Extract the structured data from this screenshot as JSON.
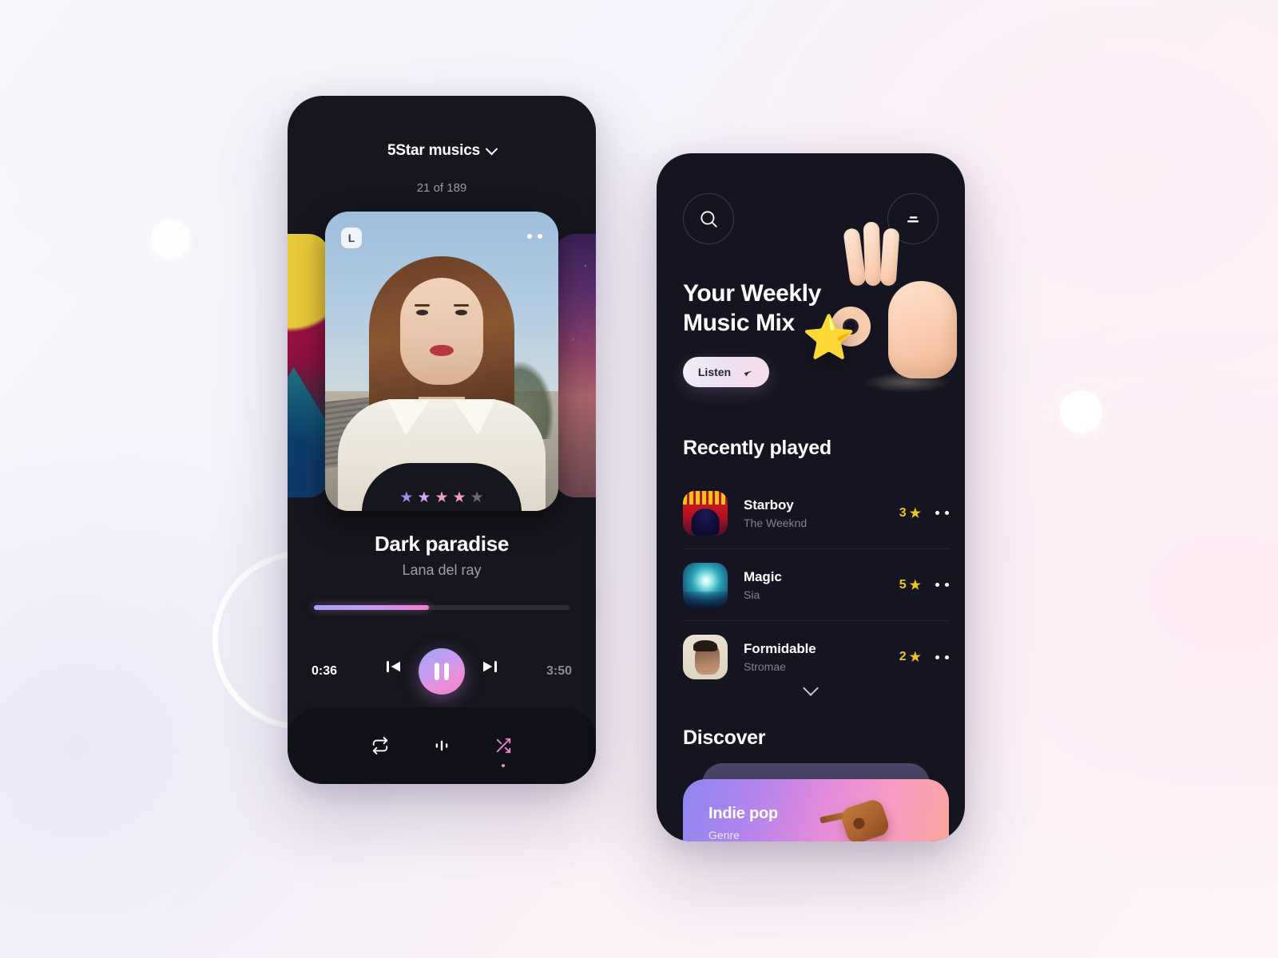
{
  "player": {
    "playlist_name": "5Star musics",
    "playlist_chevron_icon": "chevron-down-icon",
    "track_position": "21 of 189",
    "album_badge": "L",
    "album_menu_icon": "more-dots-icon",
    "rating_stars": [
      {
        "filled": true,
        "color": "#9b8cf0"
      },
      {
        "filled": true,
        "color": "#d2a8ee"
      },
      {
        "filled": true,
        "color": "#f29cc9"
      },
      {
        "filled": true,
        "color": "#f29cc9"
      },
      {
        "filled": false,
        "color": "#6a6a72"
      }
    ],
    "track_title": "Dark paradise",
    "track_artist": "Lana del ray",
    "time_current": "0:36",
    "time_total": "3:50",
    "progress_percent": 45,
    "controls": {
      "previous_icon": "skip-previous-icon",
      "play_pause_icon": "pause-icon",
      "next_icon": "skip-next-icon"
    },
    "bottom_nav": [
      {
        "name": "repeat-icon",
        "active": false
      },
      {
        "name": "equalizer-icon",
        "active": false
      },
      {
        "name": "shuffle-icon",
        "active": true
      }
    ],
    "colors": {
      "accent_start": "#a5a6f6",
      "accent_end": "#f47fd0",
      "surface": "#15161e"
    }
  },
  "home": {
    "search_icon": "search-icon",
    "menu_icon": "menu-icon",
    "hero": {
      "title": "Your Weekly\nMusic Mix",
      "button_label": "Listen",
      "button_icon": "cursor-arrow-icon",
      "emoji": "ok-hand-with-star-icon",
      "star_glyph": "⭐"
    },
    "recently_played": {
      "title": "Recently played",
      "tracks": [
        {
          "name": "Starboy",
          "artist": "The Weeknd",
          "rating": "3",
          "star_glyph": "★",
          "art": "starboy-album-art",
          "menu_icon": "more-dots-icon"
        },
        {
          "name": "Magic",
          "artist": "Sia",
          "rating": "5",
          "star_glyph": "★",
          "art": "magic-album-art",
          "menu_icon": "more-dots-icon"
        },
        {
          "name": "Formidable",
          "artist": "Stromae",
          "rating": "2",
          "star_glyph": "★",
          "art": "formidable-album-art",
          "menu_icon": "more-dots-icon"
        }
      ],
      "expand_icon": "chevron-down-icon"
    },
    "discover": {
      "title": "Discover",
      "cards": [
        {
          "title": "Indie pop",
          "subtitle": "Genre",
          "illustration": "ukulele-icon"
        }
      ]
    },
    "colors": {
      "star": "#f2c51c",
      "card_gradient_start": "#8f86f0",
      "card_gradient_end": "#fba697",
      "surface": "#141520"
    }
  }
}
